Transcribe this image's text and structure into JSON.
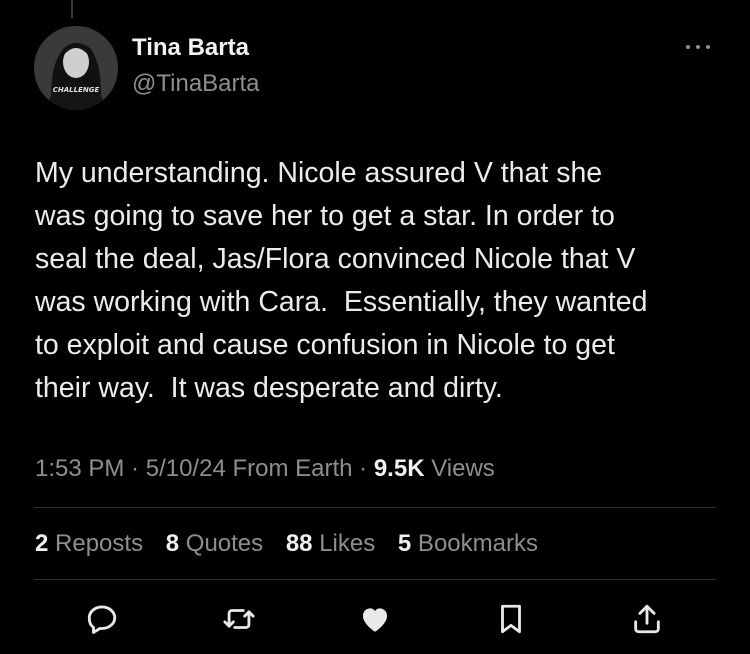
{
  "author": {
    "display_name": "Tina Barta",
    "handle": "@TinaBarta",
    "avatar_shirt_text": "CHALLENGE"
  },
  "tweet": {
    "text": "My understanding. Nicole assured V that she\nwas going to save her to get a star. In order to\nseal the deal, Jas/Flora convinced Nicole that V\nwas working with Cara.  Essentially, they wanted\nto exploit and cause confusion in Nicole to get\ntheir way.  It was desperate and dirty."
  },
  "meta": {
    "time": "1:53 PM",
    "sep1": " · ",
    "date": "5/10/24",
    "source": " From Earth",
    "sep2": " · ",
    "views_count": "9.5K",
    "views_label": " Views"
  },
  "stats": {
    "reposts": {
      "count": "2",
      "label": " Reposts"
    },
    "quotes": {
      "count": "8",
      "label": " Quotes"
    },
    "likes": {
      "count": "88",
      "label": " Likes"
    },
    "bookmarks": {
      "count": "5",
      "label": " Bookmarks"
    }
  },
  "icons": {
    "more": "more-horizontal-icon",
    "reply": "reply-icon",
    "repost": "repost-icon",
    "like": "like-heart-icon",
    "bookmark": "bookmark-icon",
    "share": "share-icon"
  },
  "colors": {
    "background": "#000000",
    "text": "#e7e9ea",
    "secondary_text": "#8b8f93",
    "divider": "#2b2f33"
  }
}
